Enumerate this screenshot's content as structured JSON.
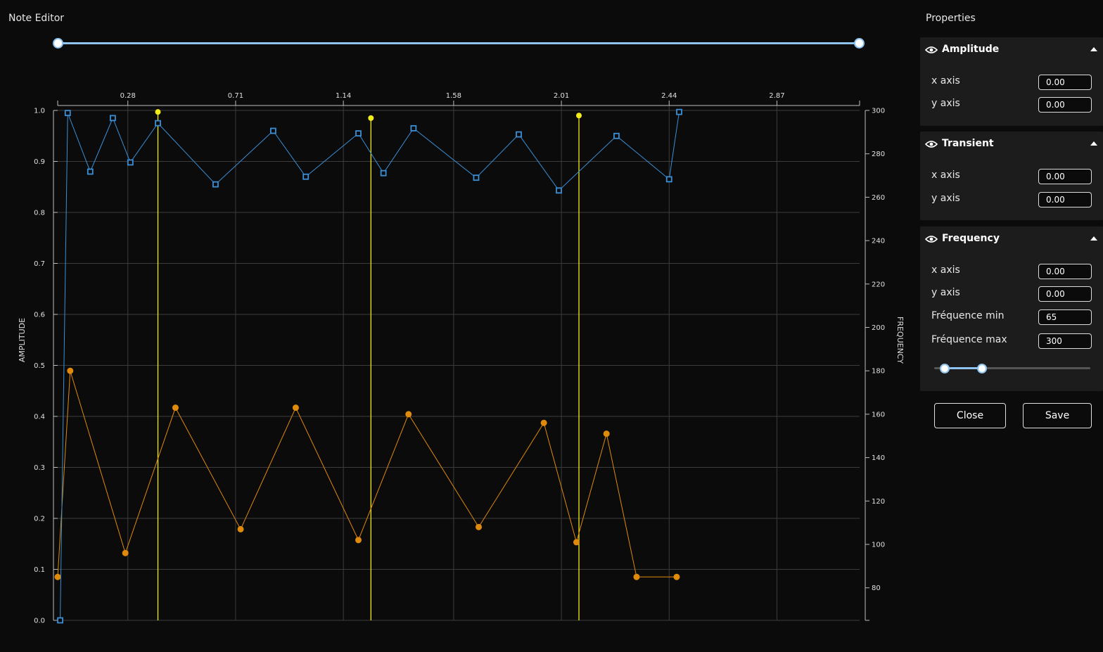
{
  "editor": {
    "title": "Note Editor"
  },
  "properties": {
    "title": "Properties",
    "sections": [
      {
        "title": "Amplitude",
        "icon": "eye-icon",
        "fields": [
          {
            "label": "x axis",
            "value": "0.00"
          },
          {
            "label": "y axis",
            "value": "0.00"
          }
        ]
      },
      {
        "title": "Transient",
        "icon": "eye-icon",
        "fields": [
          {
            "label": "x axis",
            "value": "0.00"
          },
          {
            "label": "y axis",
            "value": "0.00"
          }
        ]
      },
      {
        "title": "Frequency",
        "icon": "eye-icon",
        "fields": [
          {
            "label": "x axis",
            "value": "0.00"
          },
          {
            "label": "y axis",
            "value": "0.00"
          },
          {
            "label": "Fréquence min",
            "value": "65"
          },
          {
            "label": "Fréquence max",
            "value": "300"
          }
        ]
      }
    ]
  },
  "buttons": {
    "close": "Close",
    "save": "Save"
  },
  "colors": {
    "amplitude": "#3a8fd6",
    "frequency": "#e08a0c",
    "transient": "#f2ec18",
    "grid": "#3c3c3c",
    "axis": "#bdbdbd",
    "accent": "#8ec3ef"
  },
  "chart_data": {
    "type": "line",
    "xlim": [
      0.0,
      3.2
    ],
    "x_ticks": [
      "0.28",
      "0.71",
      "1.14",
      "1.58",
      "2.01",
      "2.44",
      "2.87"
    ],
    "x_tick_values": [
      0.28,
      0.71,
      1.14,
      1.58,
      2.01,
      2.44,
      2.87
    ],
    "ylabel": "AMPLITUDE",
    "y2label": "FREQUENCY",
    "ylim": [
      0.0,
      1.0
    ],
    "y_ticks": [
      "0.0",
      "0.1",
      "0.2",
      "0.3",
      "0.4",
      "0.5",
      "0.6",
      "0.7",
      "0.8",
      "0.9",
      "1.0"
    ],
    "y2lim": [
      65,
      300
    ],
    "y2_ticks": [
      "80",
      "100",
      "120",
      "140",
      "160",
      "180",
      "200",
      "220",
      "240",
      "260",
      "280",
      "300"
    ],
    "grid": true,
    "series": [
      {
        "axis": "left",
        "marker": "square",
        "x": [
          0.01,
          0.04,
          0.13,
          0.22,
          0.29,
          0.4,
          0.63,
          0.86,
          0.99,
          1.2,
          1.3,
          1.42,
          1.67,
          1.84,
          2.0,
          2.23,
          2.44,
          2.48
        ],
        "y": [
          0.0,
          0.995,
          0.88,
          0.985,
          0.898,
          0.975,
          0.855,
          0.96,
          0.87,
          0.955,
          0.877,
          0.965,
          0.868,
          0.953,
          0.843,
          0.95,
          0.865,
          0.997
        ]
      },
      {
        "axis": "right",
        "marker": "circle",
        "x": [
          0.0,
          0.05,
          0.27,
          0.47,
          0.73,
          0.95,
          1.2,
          1.4,
          1.68,
          1.94,
          2.07,
          2.19,
          2.31,
          2.47
        ],
        "y": [
          85,
          180,
          96,
          163,
          107,
          163,
          102,
          160,
          108,
          156,
          101,
          151,
          85,
          85
        ]
      },
      {
        "axis": "left",
        "marker": "pin",
        "x": [
          0.4,
          1.25,
          2.08
        ],
        "y": [
          0.997,
          0.985,
          0.99
        ]
      }
    ]
  }
}
